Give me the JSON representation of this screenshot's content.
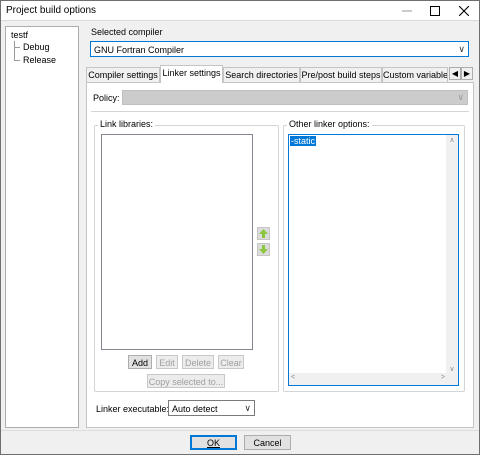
{
  "window": {
    "title": "Project build options"
  },
  "tree": {
    "root": "testf",
    "children": [
      "Debug",
      "Release"
    ]
  },
  "compiler": {
    "label": "Selected compiler",
    "value": "GNU Fortran Compiler"
  },
  "tabs": [
    {
      "label": "Compiler settings"
    },
    {
      "label": "Linker settings"
    },
    {
      "label": "Search directories"
    },
    {
      "label": "Pre/post build steps"
    },
    {
      "label": "Custom variable"
    }
  ],
  "policy": {
    "label": "Policy:"
  },
  "link_libraries": {
    "label": "Link libraries:",
    "buttons": {
      "add": "Add",
      "edit": "Edit",
      "delete": "Delete",
      "clear": "Clear"
    },
    "copy_label": "Copy selected to..."
  },
  "other_options": {
    "label": "Other linker options:",
    "text": "-static"
  },
  "linker_exe": {
    "label": "Linker executable:",
    "value": "Auto detect"
  },
  "dialog": {
    "ok": "OK",
    "cancel": "Cancel"
  },
  "colors": {
    "accent": "#0078d7",
    "arrow_green": "#8cc63f"
  }
}
